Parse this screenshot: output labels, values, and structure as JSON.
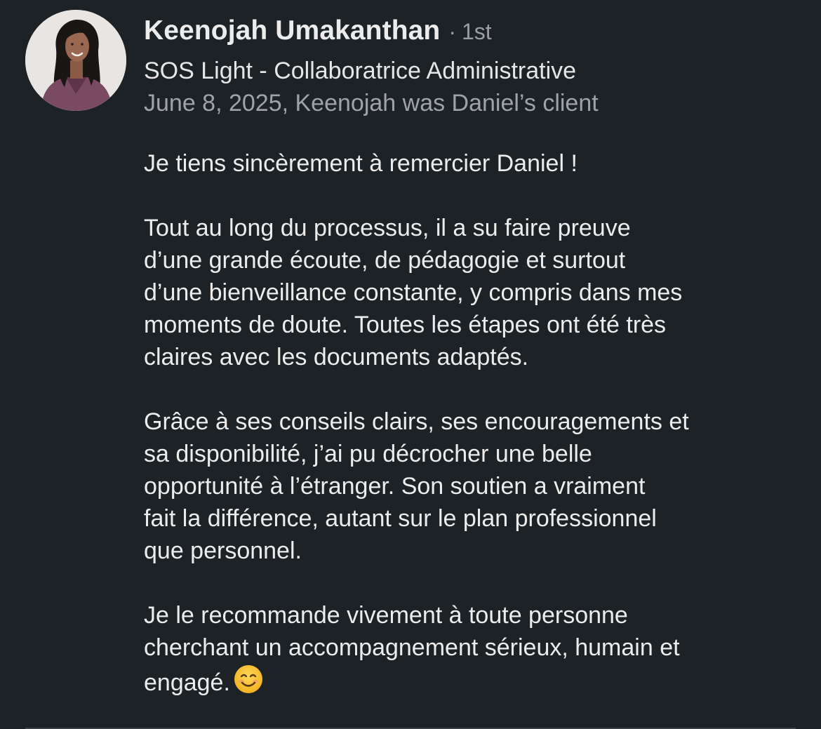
{
  "recommendation": {
    "author": {
      "name": "Keenojah Umakanthan",
      "separator": "·",
      "connection_degree": "1st",
      "headline": "SOS Light - Collaboratrice Administrative",
      "meta": "June 8, 2025, Keenojah was Daniel’s client"
    },
    "paragraphs": [
      {
        "lines": [
          "Je tiens sincèrement à remercier Daniel !"
        ]
      },
      {
        "lines": [
          "Tout au long du processus, il a su faire preuve",
          "d’une grande écoute, de pédagogie et surtout",
          "d’une bienveillance constante, y compris dans mes",
          "moments de doute. Toutes les étapes ont été très",
          "claires avec les documents adaptés."
        ]
      },
      {
        "lines": [
          "Grâce à ses conseils clairs, ses encouragements et",
          "sa disponibilité, j’ai pu décrocher une belle",
          "opportunité à l’étranger. Son soutien a vraiment",
          "fait la différence, autant sur le plan professionnel",
          "que personnel."
        ]
      },
      {
        "lines": [
          "Je le recommande vivement à toute personne",
          "cherchant un accompagnement sérieux, humain et",
          "engagé."
        ],
        "trailing_icon": "smiling-face-emoji"
      }
    ]
  },
  "colors": {
    "background": "#1d2226",
    "primary_text": "#ececec",
    "secondary_text": "#9fa3a7",
    "emoji_face": "#f7c531"
  }
}
